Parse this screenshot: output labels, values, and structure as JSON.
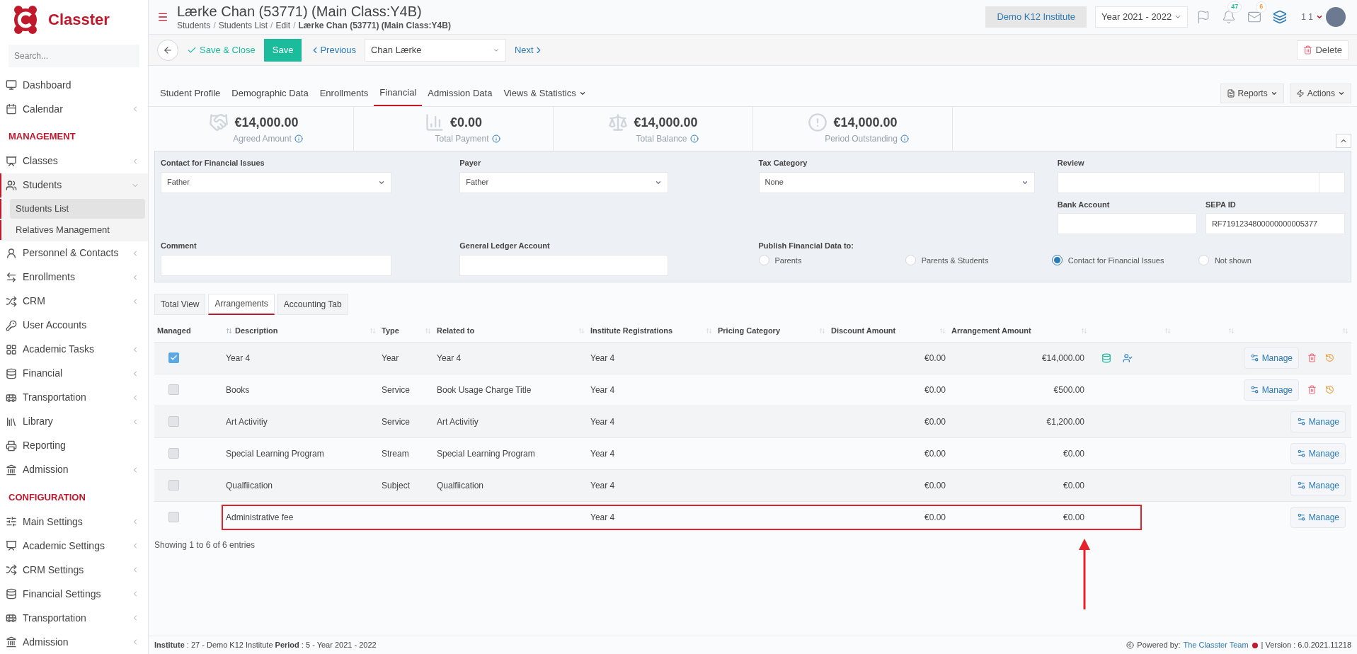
{
  "brand": {
    "name": "Classter"
  },
  "sidebar": {
    "search": {
      "placeholder": "Search..."
    },
    "items": [
      {
        "kind": "item",
        "label": "Dashboard",
        "expandable": false,
        "expanded": false,
        "selected": false
      },
      {
        "kind": "item",
        "label": "Calendar",
        "expandable": true,
        "expanded": false,
        "selected": false
      },
      {
        "kind": "section",
        "label": "MANAGEMENT"
      },
      {
        "kind": "item",
        "label": "Classes",
        "expandable": true,
        "expanded": false,
        "selected": false
      },
      {
        "kind": "item",
        "label": "Students",
        "expandable": true,
        "expanded": true,
        "selected": true,
        "children": [
          {
            "label": "Students List",
            "selected": true
          },
          {
            "label": "Relatives Management",
            "selected": false
          }
        ]
      },
      {
        "kind": "item",
        "label": "Personnel & Contacts",
        "expandable": true,
        "expanded": false,
        "selected": false
      },
      {
        "kind": "item",
        "label": "Enrollments",
        "expandable": true,
        "expanded": false,
        "selected": false
      },
      {
        "kind": "item",
        "label": "CRM",
        "expandable": true,
        "expanded": false,
        "selected": false
      },
      {
        "kind": "item",
        "label": "User Accounts",
        "expandable": false,
        "expanded": false,
        "selected": false
      },
      {
        "kind": "item",
        "label": "Academic Tasks",
        "expandable": true,
        "expanded": false,
        "selected": false
      },
      {
        "kind": "item",
        "label": "Financial",
        "expandable": true,
        "expanded": false,
        "selected": false
      },
      {
        "kind": "item",
        "label": "Transportation",
        "expandable": true,
        "expanded": false,
        "selected": false
      },
      {
        "kind": "item",
        "label": "Library",
        "expandable": true,
        "expanded": false,
        "selected": false
      },
      {
        "kind": "item",
        "label": "Reporting",
        "expandable": false,
        "expanded": false,
        "selected": false
      },
      {
        "kind": "item",
        "label": "Admission",
        "expandable": true,
        "expanded": false,
        "selected": false
      },
      {
        "kind": "section",
        "label": "CONFIGURATION"
      },
      {
        "kind": "item",
        "label": "Main Settings",
        "expandable": true,
        "expanded": false,
        "selected": false
      },
      {
        "kind": "item",
        "label": "Academic Settings",
        "expandable": true,
        "expanded": false,
        "selected": false
      },
      {
        "kind": "item",
        "label": "CRM Settings",
        "expandable": true,
        "expanded": false,
        "selected": false
      },
      {
        "kind": "item",
        "label": "Financial Settings",
        "expandable": true,
        "expanded": false,
        "selected": false
      },
      {
        "kind": "item",
        "label": "Transportation",
        "expandable": true,
        "expanded": false,
        "selected": false
      },
      {
        "kind": "item",
        "label": "Admission",
        "expandable": true,
        "expanded": false,
        "selected": false
      }
    ]
  },
  "header": {
    "title": "Lærke Chan (53771) (Main Class:Y4B)",
    "separator": "/",
    "breadcrumbs": [
      "Students",
      "Students List",
      "Edit",
      "Lærke Chan (53771) (Main Class:Y4B)"
    ],
    "institute": "Demo K12 Institute",
    "year": "Year 2021 - 2022",
    "notifications": "47",
    "messages": "6",
    "user": "1 1"
  },
  "toolbar": {
    "save_close": "Save & Close",
    "save": "Save",
    "previous": "Previous",
    "student": "Chan Lærke",
    "next": "Next",
    "delete": "Delete"
  },
  "tabs": [
    {
      "label": "Student Profile",
      "selected": false,
      "dropdown": false
    },
    {
      "label": "Demographic Data",
      "selected": false,
      "dropdown": false
    },
    {
      "label": "Enrollments",
      "selected": false,
      "dropdown": false
    },
    {
      "label": "Financial",
      "selected": true,
      "dropdown": false
    },
    {
      "label": "Admission Data",
      "selected": false,
      "dropdown": false
    },
    {
      "label": "Views & Statistics",
      "selected": false,
      "dropdown": true
    }
  ],
  "tab_actions": [
    "Reports",
    "Actions"
  ],
  "summary": [
    {
      "amount": "€14,000.00",
      "label": "Agreed Amount"
    },
    {
      "amount": "€0.00",
      "label": "Total Payment"
    },
    {
      "amount": "€14,000.00",
      "label": "Total Balance"
    },
    {
      "amount": "€14,000.00",
      "label": "Period Outstanding"
    }
  ],
  "form": {
    "contact": {
      "label": "Contact for Financial Issues",
      "value": "Father"
    },
    "payer": {
      "label": "Payer",
      "value": "Father"
    },
    "tax": {
      "label": "Tax Category",
      "value": "None"
    },
    "review": {
      "label": "Review"
    },
    "bank": {
      "label": "Bank Account"
    },
    "sepa": {
      "label": "SEPA ID",
      "value": "RF7191234800000000005377"
    },
    "comment": {
      "label": "Comment"
    },
    "ledger": {
      "label": "General Ledger Account"
    },
    "publish": {
      "label": "Publish Financial Data to:",
      "options": [
        {
          "label": "Parents",
          "selected": false
        },
        {
          "label": "Parents & Students",
          "selected": false
        },
        {
          "label": "Contact for Financial Issues",
          "selected": true
        },
        {
          "label": "Not shown",
          "selected": false
        }
      ]
    }
  },
  "subtabs": [
    {
      "label": "Total View",
      "selected": false
    },
    {
      "label": "Arrangements",
      "selected": true
    },
    {
      "label": "Accounting Tab",
      "selected": false
    }
  ],
  "table": {
    "columns": [
      "Managed",
      "Description",
      "Type",
      "Related to",
      "Institute Registrations",
      "Pricing Category",
      "Discount Amount",
      "Arrangement Amount"
    ],
    "rows": [
      {
        "checked": true,
        "description": "Year 4",
        "type": "Year",
        "related": "Year 4",
        "registration": "Year 4",
        "discount": "€0.00",
        "amount": "€14,000.00",
        "kind": "editable",
        "manage": "Manage",
        "highlighted": false
      },
      {
        "checked": false,
        "description": "Books",
        "type": "Service",
        "related": "Book Usage Charge Title",
        "registration": "Year 4",
        "discount": "€0.00",
        "amount": "€500.00",
        "kind": "removable",
        "manage": "Manage",
        "highlighted": false
      },
      {
        "checked": false,
        "description": "Art Activitiy",
        "type": "Service",
        "related": "Art Activitiy",
        "registration": "Year 4",
        "discount": "€0.00",
        "amount": "€1,200.00",
        "kind": "plain",
        "manage": "Manage",
        "highlighted": false
      },
      {
        "checked": false,
        "description": "Special Learning Program",
        "type": "Stream",
        "related": "Special Learning Program",
        "registration": "Year 4",
        "discount": "€0.00",
        "amount": "€0.00",
        "kind": "plain",
        "manage": "Manage",
        "highlighted": false
      },
      {
        "checked": false,
        "description": "Qualfiication",
        "type": "Subject",
        "related": "Qualfiication",
        "registration": "Year 4",
        "discount": "€0.00",
        "amount": "€0.00",
        "kind": "plain",
        "manage": "Manage",
        "highlighted": false
      },
      {
        "checked": false,
        "description": "Administrative fee",
        "type": "",
        "related": "",
        "registration": "Year 4",
        "discount": "€0.00",
        "amount": "€0.00",
        "kind": "plain",
        "manage": "Manage",
        "highlighted": true
      }
    ],
    "info": "Showing 1 to 6 of 6 entries"
  },
  "footer": {
    "context": "**Institute** : 27 - Demo K12 Institute **Period** : 5 - Year 2021 - 2022",
    "powered": "Powered by:",
    "team": "The Classter Team",
    "version": "| Version : 6.0.2021.11218"
  }
}
